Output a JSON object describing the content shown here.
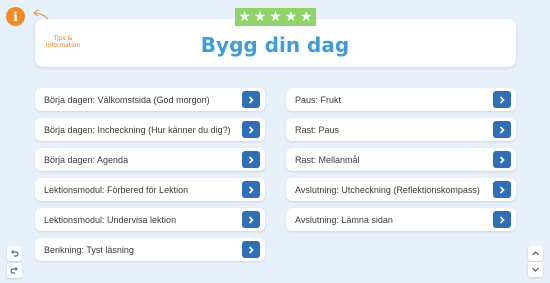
{
  "header": {
    "info_icon": "i",
    "tips_label": "Tips & Information",
    "stars": [
      "★",
      "★",
      "★",
      "★",
      "★"
    ],
    "title": "Bygg din dag"
  },
  "left_items": [
    {
      "label": "Börja dagen: Välkomstsida (God morgon)"
    },
    {
      "label": "Börja dagen: Incheckning (Hur känner du dig?)"
    },
    {
      "label": "Börja dagen: Agenda"
    },
    {
      "label": "Lektionsmodul: Förbered för Lektion"
    },
    {
      "label": "Lektionsmodul: Undervisa lektion"
    },
    {
      "label": "Berikning: Tyst läsning"
    }
  ],
  "right_items": [
    {
      "label": "Paus: Frukt"
    },
    {
      "label": "Rast: Paus"
    },
    {
      "label": "Rast: Mellanmål"
    },
    {
      "label": "Avslutning: Utcheckning (Reflektionskompass)"
    },
    {
      "label": "Avslutning: Lämna sidan"
    }
  ],
  "colors": {
    "background": "#e7f1fb",
    "accent_blue": "#2f6fb8",
    "title_blue": "#3f9ed8",
    "orange": "#ee8c2a",
    "star_band": "#8fd36b"
  }
}
